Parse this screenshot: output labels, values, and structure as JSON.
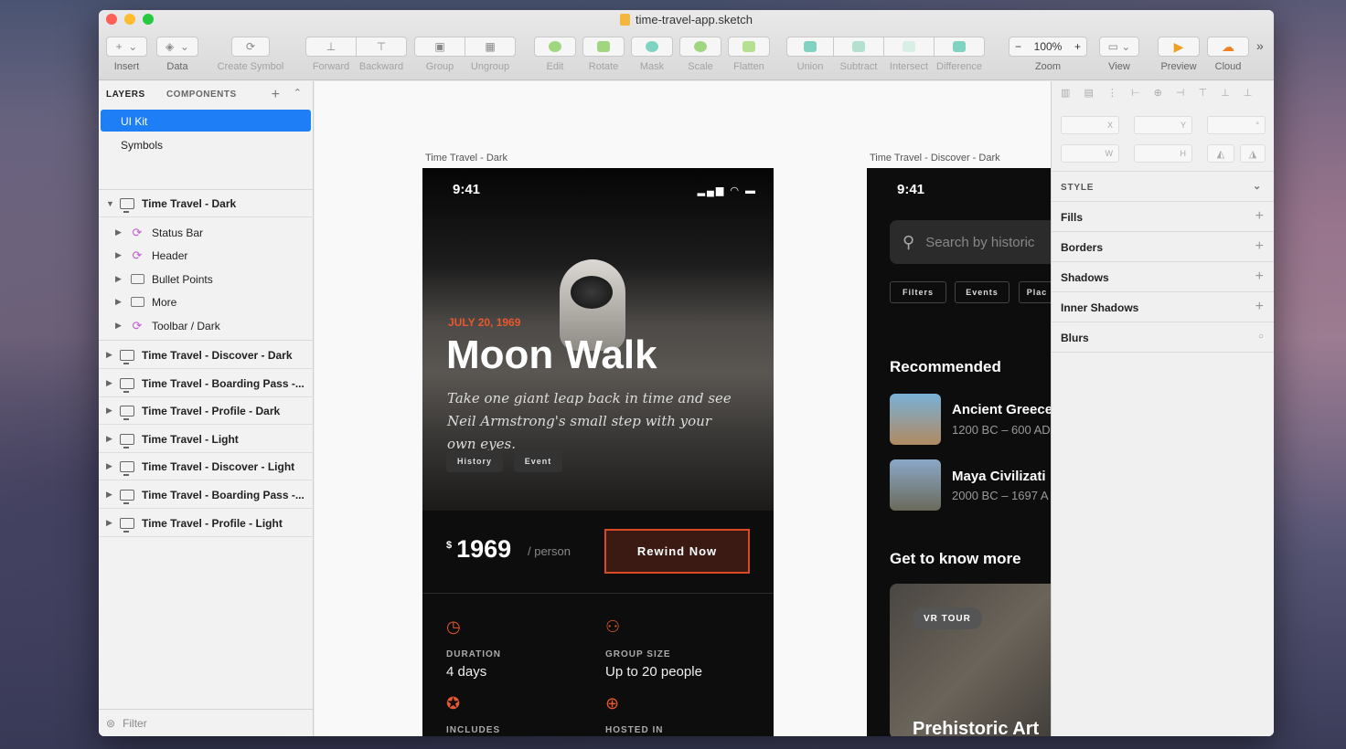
{
  "window": {
    "title": "time-travel-app.sketch"
  },
  "toolbar": {
    "insert": "Insert",
    "data": "Data",
    "create_symbol": "Create Symbol",
    "forward": "Forward",
    "backward": "Backward",
    "group": "Group",
    "ungroup": "Ungroup",
    "edit": "Edit",
    "rotate": "Rotate",
    "mask": "Mask",
    "scale": "Scale",
    "flatten": "Flatten",
    "union": "Union",
    "subtract": "Subtract",
    "intersect": "Intersect",
    "difference": "Difference",
    "zoom_value": "100%",
    "zoom": "Zoom",
    "view": "View",
    "preview": "Preview",
    "cloud": "Cloud"
  },
  "sidebar": {
    "tab_layers": "LAYERS",
    "tab_components": "COMPONENTS",
    "pages": [
      {
        "label": "UI Kit"
      },
      {
        "label": "Symbols"
      }
    ],
    "expanded": {
      "label": "Time Travel - Dark",
      "children": [
        {
          "label": "Status Bar",
          "icon": "symbol-icon"
        },
        {
          "label": "Header",
          "icon": "symbol-icon"
        },
        {
          "label": "Bullet Points",
          "icon": "folder-icon"
        },
        {
          "label": "More",
          "icon": "folder-icon"
        },
        {
          "label": "Toolbar / Dark",
          "icon": "symbol-icon"
        }
      ]
    },
    "artboards": [
      {
        "label": "Time Travel - Discover - Dark"
      },
      {
        "label": "Time Travel - Boarding Pass -..."
      },
      {
        "label": "Time Travel - Profile - Dark"
      },
      {
        "label": "Time Travel - Light"
      },
      {
        "label": "Time Travel - Discover - Light"
      },
      {
        "label": "Time Travel - Boarding Pass -..."
      },
      {
        "label": "Time Travel - Profile - Light"
      }
    ],
    "filter": "Filter"
  },
  "artboard1": {
    "label": "Time Travel - Dark",
    "time": "9:41",
    "date": "JULY 20, 1969",
    "title": "Moon Walk",
    "description": "Take one giant leap back in time and see Neil Armstrong's small step with your own eyes.",
    "tags": [
      "History",
      "Event"
    ],
    "currency": "$",
    "price": "1969",
    "per": "/ person",
    "cta": "Rewind Now",
    "duration_label": "DURATION",
    "duration": "4 days",
    "group_label": "GROUP SIZE",
    "group": "Up to 20 people",
    "includes_label": "INCLUDES",
    "hosted_label": "HOSTED IN"
  },
  "artboard2": {
    "label": "Time Travel - Discover - Dark",
    "time": "9:41",
    "search_placeholder": "Search by historic",
    "filters": [
      "Filters",
      "Events",
      "Plac"
    ],
    "recommended": "Recommended",
    "items": [
      {
        "title": "Ancient Greece",
        "sub": "1200 BC – 600 AD"
      },
      {
        "title": "Maya Civilizati",
        "sub": "2000 BC – 1697 A"
      }
    ],
    "more": "Get to know more",
    "vr": "VR TOUR",
    "card_title": "Prehistoric Art"
  },
  "inspector": {
    "x": "X",
    "y": "Y",
    "w": "W",
    "h": "H",
    "rot": "°",
    "style": "STYLE",
    "sections": [
      "Fills",
      "Borders",
      "Shadows",
      "Inner Shadows",
      "Blurs"
    ]
  },
  "colors": {
    "accent": "#1d7ef5",
    "orange": "#e8582e"
  }
}
